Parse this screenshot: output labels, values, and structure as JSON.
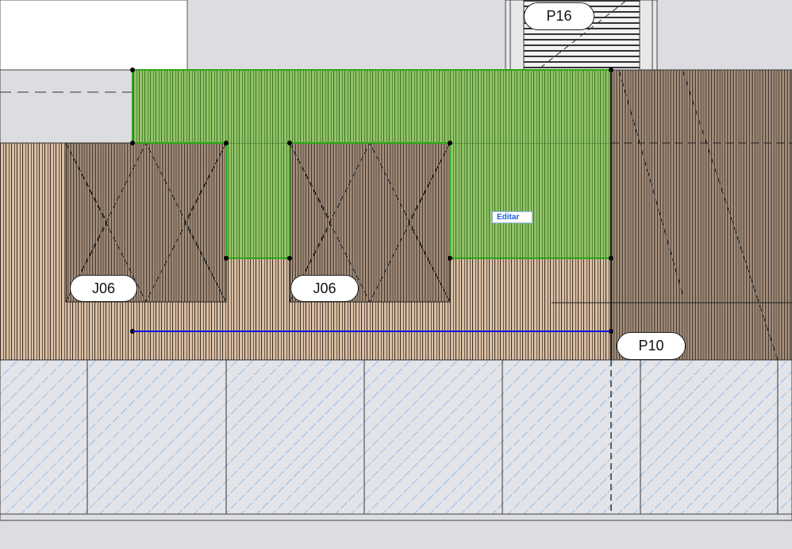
{
  "labels": {
    "window_left": "J06",
    "window_right": "J06",
    "door_top": "P16",
    "door_right": "P10"
  },
  "context_button": {
    "label": "Editar"
  },
  "colors": {
    "background": "#dcdde0",
    "wood": "#d8bea4",
    "selection_green": "#3cc81e",
    "selection_line": "#1010e0",
    "hatch_blue": "#4a9be8"
  }
}
